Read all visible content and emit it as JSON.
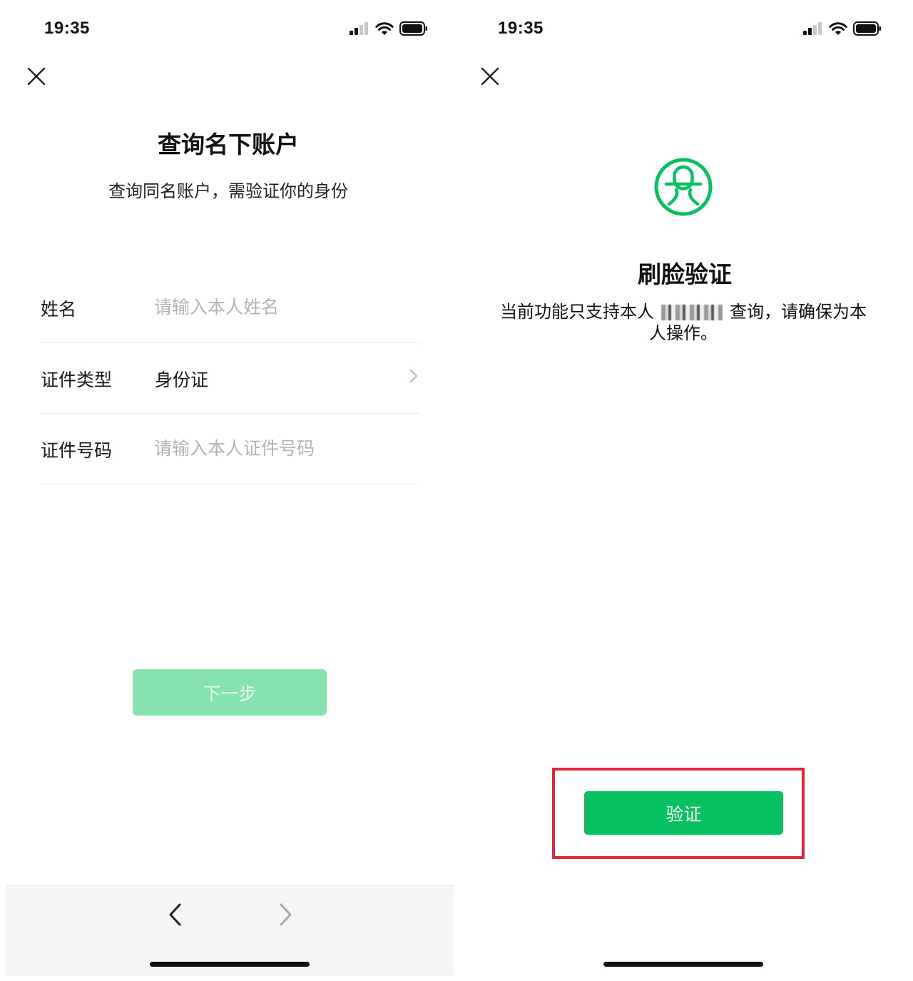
{
  "colors": {
    "brand_green": "#07c160",
    "disabled_green": "#86e3b0",
    "highlight_red": "#e0283a",
    "placeholder_gray": "#b3b3b3"
  },
  "left_screen": {
    "status_bar": {
      "time": "19:35",
      "icons": [
        "signal-icon",
        "wifi-icon",
        "battery-icon"
      ]
    },
    "close_icon": "close-icon",
    "title": "查询名下账户",
    "subtitle": "查询同名账户，需验证你的身份",
    "form": {
      "name": {
        "label": "姓名",
        "placeholder": "请输入本人姓名",
        "value": ""
      },
      "id_type": {
        "label": "证件类型",
        "value": "身份证",
        "icon": "chevron-right-icon"
      },
      "id_number": {
        "label": "证件号码",
        "placeholder": "请输入本人证件号码",
        "value": ""
      }
    },
    "next_button": "下一步",
    "browser_nav": {
      "back_icon": "back-arrow-icon",
      "forward_icon": "forward-arrow-icon"
    }
  },
  "right_screen": {
    "status_bar": {
      "time": "19:35",
      "icons": [
        "signal-icon",
        "wifi-icon",
        "battery-icon"
      ]
    },
    "close_icon": "close-icon",
    "face_icon": "face-verification-icon",
    "title": "刷脸验证",
    "description_before": "当前功能只支持本人",
    "description_after": "查询，请确保为本人操作。",
    "verify_button": "验证"
  }
}
